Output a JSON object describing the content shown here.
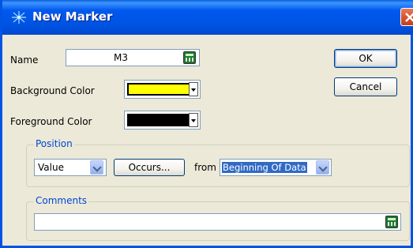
{
  "window": {
    "title": "New Marker"
  },
  "name_field": {
    "label": "Name",
    "value": "M3"
  },
  "background_color": {
    "label": "Background Color",
    "color": "#ffff00"
  },
  "foreground_color": {
    "label": "Foreground Color",
    "color": "#000000"
  },
  "buttons": {
    "ok": "OK",
    "cancel": "Cancel"
  },
  "position": {
    "legend": "Position",
    "type_value": "Value",
    "occurs_label": "Occurs...",
    "from_label": "from",
    "from_value": "Beginning Of Data"
  },
  "comments": {
    "legend": "Comments",
    "value": ""
  },
  "colors": {
    "title_bar": "#0054e3",
    "group_legend": "#0046d5",
    "selection": "#316ac5"
  },
  "icons": [
    "spark-icon",
    "close-icon",
    "calculator-icon",
    "chevron-down-icon"
  ]
}
